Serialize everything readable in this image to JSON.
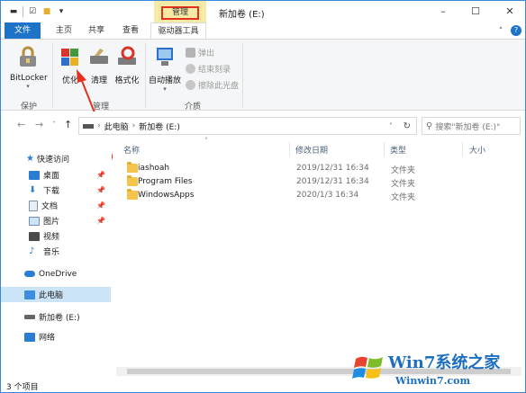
{
  "window": {
    "title": "新加卷 (E:)",
    "context_tab_label": "管理"
  },
  "ribbon_tabs": [
    {
      "label": "文件"
    },
    {
      "label": "主页"
    },
    {
      "label": "共享"
    },
    {
      "label": "查看"
    },
    {
      "label": "驱动器工具"
    }
  ],
  "ribbon": {
    "bitlocker": "BitLocker",
    "optimize": "优化",
    "cleanup": "清理",
    "format": "格式化",
    "autoplay": "自动播放",
    "eject": "弹出",
    "finalize": "结束刻录",
    "erase": "擦除此光盘",
    "group_protect": "保护",
    "group_manage": "管理",
    "group_media": "介质"
  },
  "address": {
    "path_root": "此电脑",
    "path_current": "新加卷 (E:)",
    "search_placeholder": "搜索\"新加卷 (E:)\""
  },
  "nav": {
    "quick_access": "快速访问",
    "desktop": "桌面",
    "downloads": "下载",
    "documents": "文档",
    "pictures": "图片",
    "videos": "视频",
    "music": "音乐",
    "onedrive": "OneDrive",
    "this_pc": "此电脑",
    "drive_e": "新加卷 (E:)",
    "network": "网络"
  },
  "columns": {
    "name": "名称",
    "modified": "修改日期",
    "type": "类型",
    "size": "大小"
  },
  "files": [
    {
      "name": "iashoah",
      "date": "2019/12/31 16:34",
      "type": "文件夹"
    },
    {
      "name": "Program Files",
      "date": "2019/12/31 16:34",
      "type": "文件夹"
    },
    {
      "name": "WindowsApps",
      "date": "2020/1/3 16:34",
      "type": "文件夹"
    }
  ],
  "status": {
    "count": "3 个项目"
  },
  "watermark": {
    "title": "Win7系统之家",
    "url": "Winwin7.com"
  },
  "colors": {
    "accent": "#1e73c8",
    "highlight_box": "#e5301e",
    "arrow": "#e5301e",
    "context_tab": "#f5e9a6",
    "selection": "#cce4f7"
  }
}
